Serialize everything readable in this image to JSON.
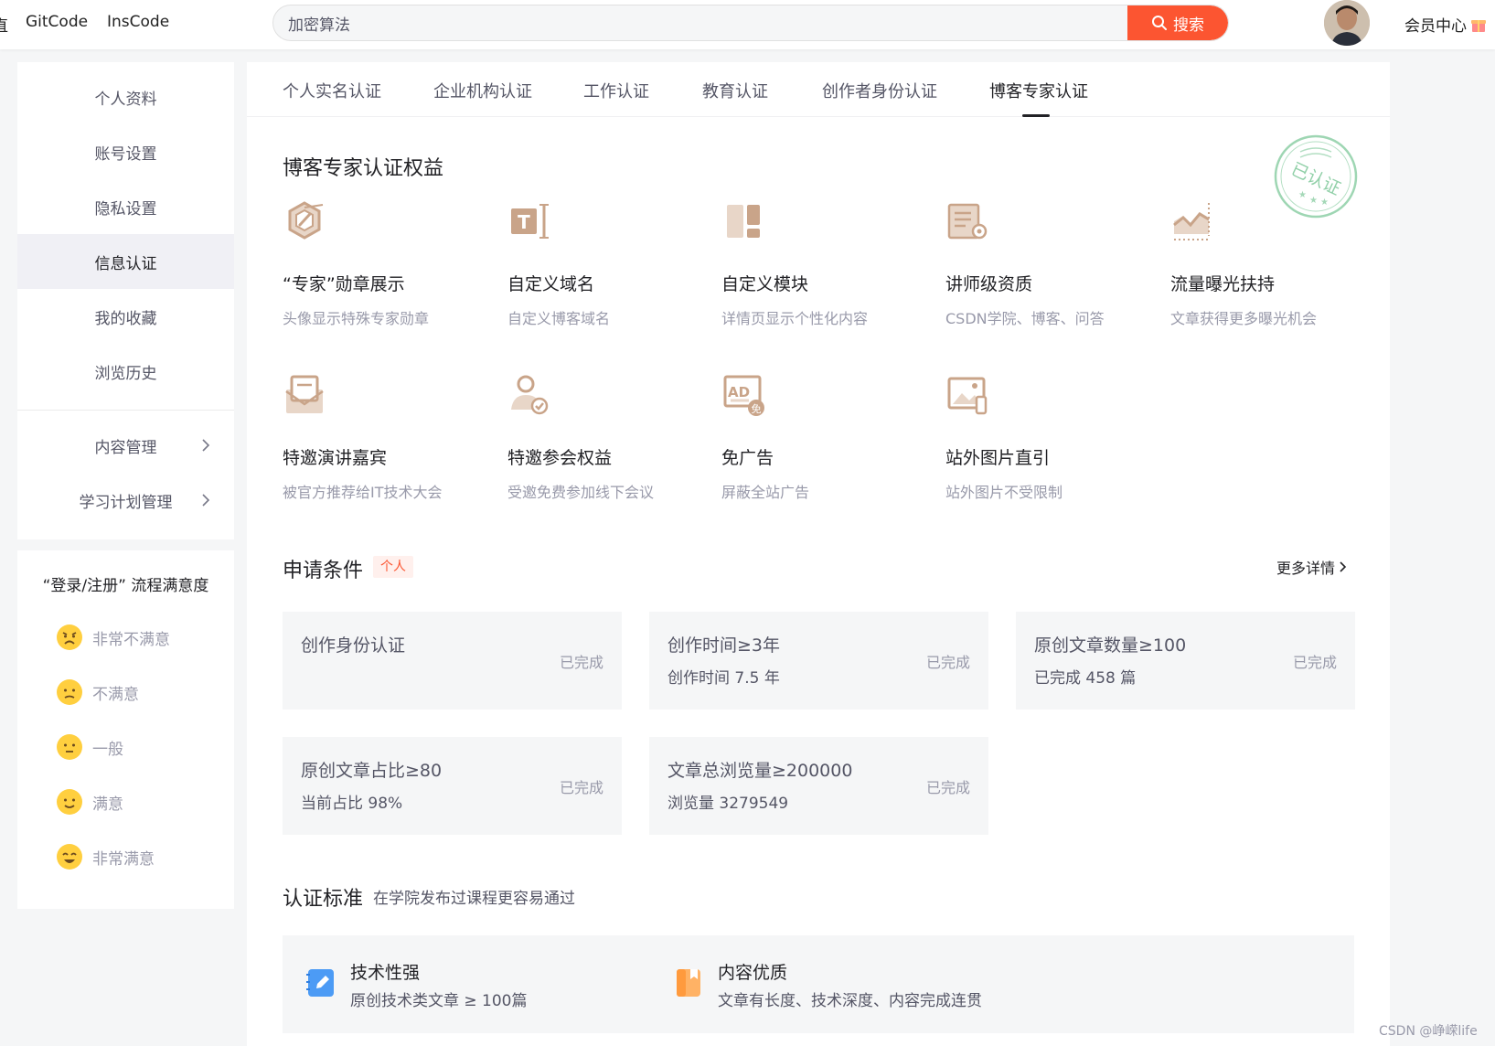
{
  "topbar": {
    "nav_cut": "直",
    "gitcode": "GitCode",
    "inscode": "InsCode",
    "search_value": "加密算法",
    "search_button": "搜索",
    "member_center": "会员中心"
  },
  "sidebar": {
    "items": [
      {
        "label": "个人资料"
      },
      {
        "label": "账号设置"
      },
      {
        "label": "隐私设置"
      },
      {
        "label": "信息认证"
      },
      {
        "label": "我的收藏"
      },
      {
        "label": "浏览历史"
      },
      {
        "label": "内容管理"
      },
      {
        "label": "学习计划管理"
      }
    ],
    "active": "信息认证"
  },
  "survey": {
    "title": "“登录/注册” 流程满意度",
    "options": [
      {
        "label": "非常不满意"
      },
      {
        "label": "不满意"
      },
      {
        "label": "一般"
      },
      {
        "label": "满意"
      },
      {
        "label": "非常满意"
      }
    ]
  },
  "tabs": [
    {
      "label": "个人实名认证"
    },
    {
      "label": "企业机构认证"
    },
    {
      "label": "工作认证"
    },
    {
      "label": "教育认证"
    },
    {
      "label": "创作者身份认证"
    },
    {
      "label": "博客专家认证"
    }
  ],
  "active_tab": "博客专家认证",
  "benefits": {
    "title": "博客专家认证权益",
    "stamp_text": "已认证",
    "items": [
      {
        "name": "“专家”勋章展示",
        "desc": "头像显示特殊专家勋章",
        "icon": "medal-icon"
      },
      {
        "name": "自定义域名",
        "desc": "自定义博客域名",
        "icon": "text-cursor-icon"
      },
      {
        "name": "自定义模块",
        "desc": "详情页显示个性化内容",
        "icon": "layout-blocks-icon"
      },
      {
        "name": "讲师级资质",
        "desc": "CSDN学院、博客、问答",
        "icon": "certificate-icon"
      },
      {
        "name": "流量曝光扶持",
        "desc": "文章获得更多曝光机会",
        "icon": "traffic-chart-icon"
      },
      {
        "name": "特邀演讲嘉宾",
        "desc": "被官方推荐给IT技术大会",
        "icon": "invitation-icon"
      },
      {
        "name": "特邀参会权益",
        "desc": "受邀免费参加线下会议",
        "icon": "attendee-icon"
      },
      {
        "name": "免广告",
        "desc": "屏蔽全站广告",
        "icon": "ad-free-icon"
      },
      {
        "name": "站外图片直引",
        "desc": "站外图片不受限制",
        "icon": "image-link-icon"
      }
    ]
  },
  "conditions": {
    "title": "申请条件",
    "tag": "个人",
    "more": "更多详情",
    "items": [
      {
        "title": "创作身份认证",
        "sub": "",
        "status": "已完成"
      },
      {
        "title": "创作时间≥3年",
        "sub": "创作时间 7.5 年",
        "status": "已完成"
      },
      {
        "title": "原创文章数量≥100",
        "sub": "已完成 458 篇",
        "status": "已完成"
      },
      {
        "title": "原创文章占比≥80",
        "sub": "当前占比 98%",
        "status": "已完成"
      },
      {
        "title": "文章总浏览量≥200000",
        "sub": "浏览量 3279549",
        "status": "已完成"
      }
    ]
  },
  "standard": {
    "title": "认证标准",
    "subtitle": "在学院发布过课程更容易通过",
    "items": [
      {
        "name": "技术性强",
        "desc": "原创技术类文章 ≥ 100篇"
      },
      {
        "name": "内容优质",
        "desc": "文章有长度、技术深度、内容完成连贯"
      }
    ]
  },
  "watermark": "CSDN @峥嵘life",
  "colors": {
    "accent": "#fc5531",
    "icon_brown": "#c9a489",
    "page_bg": "#f5f6f7",
    "stamp_green": "#7ec89a"
  }
}
